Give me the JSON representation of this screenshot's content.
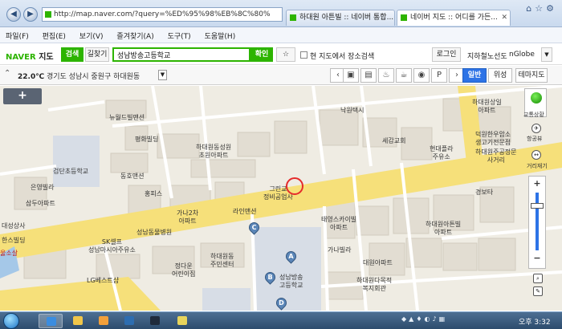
{
  "browser": {
    "url": "http://map.naver.com/?query=%ED%95%98%EB%8C%80%",
    "tabs": [
      {
        "label": "하대원 아튼빌 :: 네이버 통합..."
      },
      {
        "label": "네이버 지도 :: 어디를 가든..."
      }
    ],
    "menu": [
      "파일(F)",
      "편집(E)",
      "보기(V)",
      "즐겨찾기(A)",
      "도구(T)",
      "도움말(H)"
    ]
  },
  "naver": {
    "logo_primary": "NAVER",
    "logo_secondary": "지도",
    "search_tab": "검색",
    "directions_tab": "길찾기",
    "search_value": "성남방송고등학교",
    "confirm_button": "확인",
    "star_icon": "☆",
    "checkbox_label": "현 지도에서 장소검색",
    "login_button": "로그인",
    "subway_link": "지하철노선도",
    "nglobe_link": "nGlobe"
  },
  "toolbar": {
    "temperature": "22.0℃",
    "location": "경기도 성남시 중원구 하대원동",
    "view_normal": "일반",
    "view_satellite": "위성",
    "view_theme": "테마지도"
  },
  "map": {
    "expand_label": "+",
    "labels": {
      "nakwon_taxi": "낙원택시",
      "hadaewon_sangil": "하대원상일\n아파트",
      "newdongbo": "뉴월드빌맨션",
      "pyeonghwa": "평화빌딩",
      "hadaewon_sungwon": "하대원동성원\n초원아파트",
      "sechang": "세감교회",
      "hyundaefashion": "현대플라\n주유소",
      "deokwon": "덕원한우암소\n생고기전문점",
      "hadaewon_gongjeong": "하대원주공정문\n사거리",
      "gumdan_elem": "검단초등학교",
      "dongho": "동호맨션",
      "eunyoung": "은영빌라",
      "samdu": "삼두아파트",
      "hongpiseu": "홍피스",
      "garam": "가나2차\n아파트",
      "lion": "라인맨션",
      "grand": "그린교\n정비공업사",
      "gyeongbo": "경보타",
      "taeyeong": "태영스카이빌\n아파트",
      "hadaewon_artonbil": "하대원아튼빌\n아파트",
      "daeseong": "대성상사",
      "hanspill": "한스빌딩",
      "sk": "SK셀프\n성남마시아주유소",
      "seongnam_dongmul": "성남동물병원",
      "hadaewon_jumin": "하대원동\n주민센터",
      "jeongdawon": "정다운\n어린이집",
      "lg": "LG베스트샵",
      "gana_villa": "가나빌라",
      "daewon_apt": "대원아파트",
      "hadaewon_welfare": "하대원다목적\n복지회관",
      "school": "성남방송\n고등학교",
      "red_sangsa": "울소살",
      "traffic_label": "교통상황",
      "ruler_label": "거리재기",
      "route_label": "항공뷰"
    },
    "markers": [
      "A",
      "B",
      "C",
      "D"
    ]
  },
  "taskbar": {
    "clock": "오후 3:32"
  },
  "colors": {
    "naver_green": "#2db400",
    "road_yellow": "#f6e07a",
    "active_blue": "#2d73e6",
    "highlight_red": "#e52b2b"
  }
}
